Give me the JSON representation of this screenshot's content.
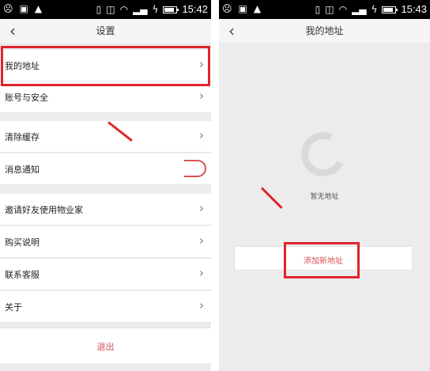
{
  "left_screen": {
    "status": {
      "time": "15:42",
      "icons": [
        "face-icon",
        "image-icon",
        "warning-icon",
        "no-sim-icon",
        "mute-icon",
        "wifi-icon",
        "signal-icon",
        "signal-icon",
        "charging-icon",
        "battery-icon"
      ]
    },
    "title": "设置",
    "items": [
      {
        "label": "我的地址"
      },
      {
        "label": "账号与安全"
      },
      {
        "label": "清除缓存"
      },
      {
        "label": "消息通知"
      },
      {
        "label": "邀请好友使用物业家"
      },
      {
        "label": "购买说明"
      },
      {
        "label": "联系客服"
      },
      {
        "label": "关于"
      }
    ],
    "logout": "退出"
  },
  "right_screen": {
    "status": {
      "time": "15:43"
    },
    "title": "我的地址",
    "empty_text": "暂无地址",
    "add_button": "添加新地址"
  },
  "colors": {
    "accent": "#e0242c",
    "toggle": "#d94f55",
    "logout": "#d0505a"
  }
}
